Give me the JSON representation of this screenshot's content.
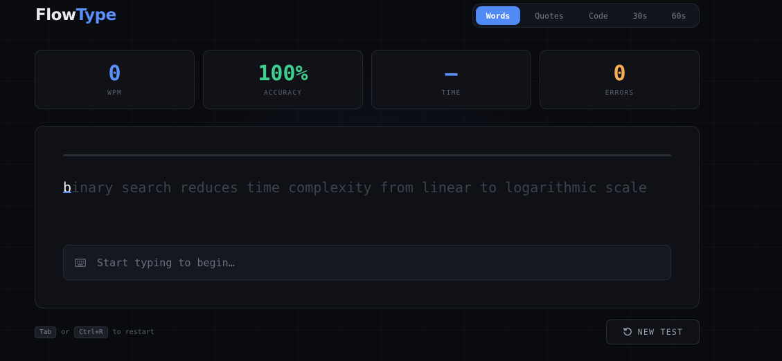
{
  "app": {
    "name_part1": "Flow",
    "name_part2": "Type"
  },
  "modes": {
    "selected": "Words",
    "items": [
      {
        "label": "Words"
      },
      {
        "label": "Quotes"
      },
      {
        "label": "Code"
      },
      {
        "label": "30s"
      },
      {
        "label": "60s"
      }
    ]
  },
  "stats": {
    "wpm": {
      "value": "0",
      "label": "WPM",
      "color": "#5b8ff9"
    },
    "accuracy": {
      "value": "100%",
      "label": "ACCURACY",
      "color": "#3ecf8e"
    },
    "time": {
      "value": "—",
      "label": "TIME",
      "color": "#5b8ff9"
    },
    "errors": {
      "value": "0",
      "label": "ERRORS",
      "color": "#f6ad55"
    }
  },
  "typing": {
    "progress": 0,
    "current_char": "b",
    "remaining_text": "inary search reduces time complexity from linear to logarithmic scale",
    "input_value": "",
    "input_placeholder": "Start typing to begin…",
    "input_icon": "keyboard-icon"
  },
  "footer": {
    "key1": "Tab",
    "or_text": "or",
    "key2": "Ctrl+R",
    "hint_text": "to restart",
    "new_test_label": "NEW TEST",
    "new_test_icon": "restart-icon"
  },
  "colors": {
    "accent": "#4f8af7",
    "success": "#3ecf8e",
    "warning": "#f6ad55"
  }
}
